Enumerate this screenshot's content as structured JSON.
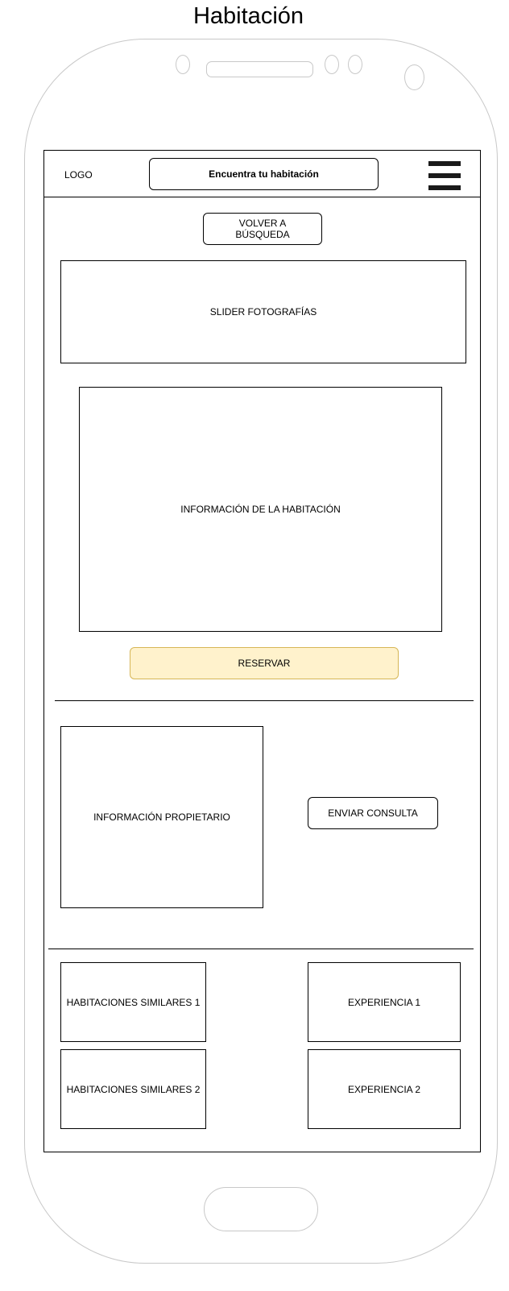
{
  "page": {
    "title": "Habitación"
  },
  "header": {
    "logo": "LOGO",
    "search_label": "Encuentra tu habitación",
    "menu_icon": "hamburger-menu-icon"
  },
  "main": {
    "back_button": "VOLVER A\nBÚSQUEDA",
    "slider": "SLIDER FOTOGRAFÍAS",
    "room_info": "INFORMACIÓN DE LA HABITACIÓN",
    "reserve_button": "RESERVAR",
    "owner_info": "INFORMACIÓN PROPIETARIO",
    "send_query_button": "ENVIAR CONSULTA",
    "similar_rooms": [
      "HABITACIONES SIMILARES 1",
      "HABITACIONES SIMILARES 2"
    ],
    "experiences": [
      "EXPERIENCIA 1",
      "EXPERIENCIA 2"
    ]
  },
  "colors": {
    "outline": "#000000",
    "phone_frame": "#c8c8c8",
    "reserve_fill": "#fff2cc",
    "reserve_border": "#d6b656",
    "menu_bars": "#1a1a1a"
  }
}
